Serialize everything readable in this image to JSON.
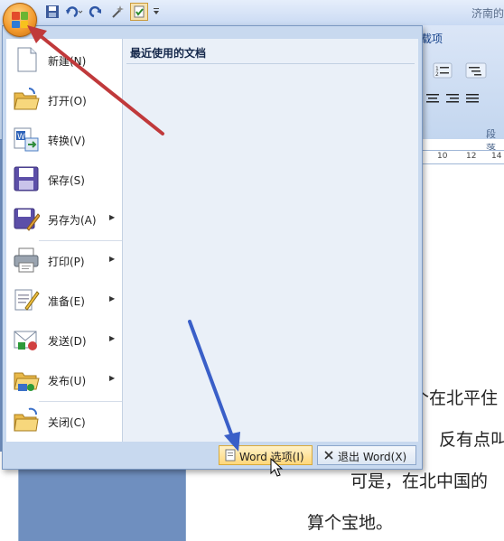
{
  "window": {
    "title": "济南的"
  },
  "ribbon": {
    "tab_label": "载项",
    "paragraph_label": "段落",
    "ruler_ticks": [
      "10",
      "12",
      "14"
    ]
  },
  "document": {
    "lines": [
      "个在北平住",
      "反有点叫",
      "可是，在北中国的",
      "算个宝地。"
    ]
  },
  "office_menu": {
    "recent_title": "最近使用的文档",
    "items": [
      {
        "label": "新建(N)",
        "icon": "new-document-icon",
        "submenu": false
      },
      {
        "label": "打开(O)",
        "icon": "open-folder-icon",
        "submenu": false
      },
      {
        "label": "转换(V)",
        "icon": "convert-icon",
        "submenu": false
      },
      {
        "label": "保存(S)",
        "icon": "save-disk-icon",
        "submenu": false
      },
      {
        "label": "另存为(A)",
        "icon": "save-as-icon",
        "submenu": true
      },
      {
        "label": "打印(P)",
        "icon": "printer-icon",
        "submenu": true
      },
      {
        "label": "准备(E)",
        "icon": "prepare-icon",
        "submenu": true
      },
      {
        "label": "发送(D)",
        "icon": "send-icon",
        "submenu": true
      },
      {
        "label": "发布(U)",
        "icon": "publish-icon",
        "submenu": true
      },
      {
        "label": "关闭(C)",
        "icon": "close-folder-icon",
        "submenu": false
      }
    ],
    "options_button": "Word 选项(I)",
    "exit_button": "退出 Word(X)"
  },
  "colors": {
    "annotation_red": "#c0393b",
    "annotation_blue": "#3a5fc8",
    "office_orange": "#f29a2d"
  }
}
